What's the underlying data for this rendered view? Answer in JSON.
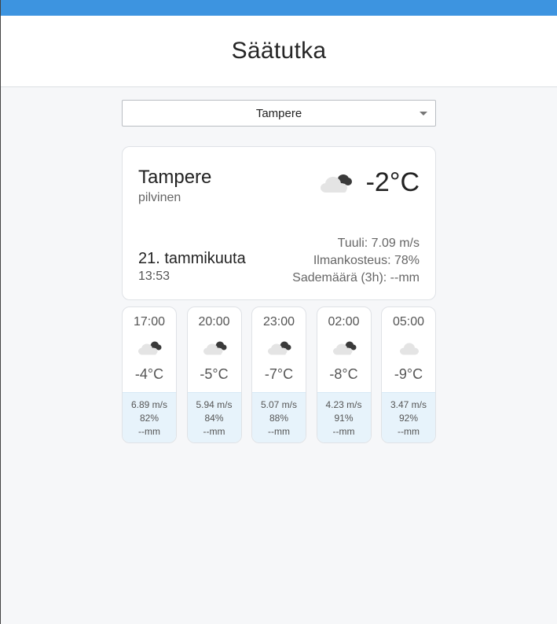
{
  "app": {
    "title": "Säätutka"
  },
  "city_select": {
    "selected": "Tampere"
  },
  "current": {
    "city": "Tampere",
    "description": "pilvinen",
    "temperature": "-2°C",
    "icon": "broken-clouds-icon",
    "date": "21. tammikuuta",
    "time": "13:53",
    "wind": "Tuuli: 7.09 m/s",
    "humidity": "Ilmankosteus: 78%",
    "precipitation": "Sademäärä (3h): --mm"
  },
  "forecast": [
    {
      "time": "17:00",
      "icon": "broken-clouds-icon",
      "temp": "-4°C",
      "wind": "6.89 m/s",
      "humidity": "82%",
      "rain": "--mm"
    },
    {
      "time": "20:00",
      "icon": "broken-clouds-icon",
      "temp": "-5°C",
      "wind": "5.94 m/s",
      "humidity": "84%",
      "rain": "--mm"
    },
    {
      "time": "23:00",
      "icon": "broken-clouds-icon",
      "temp": "-7°C",
      "wind": "5.07 m/s",
      "humidity": "88%",
      "rain": "--mm"
    },
    {
      "time": "02:00",
      "icon": "broken-clouds-icon",
      "temp": "-8°C",
      "wind": "4.23 m/s",
      "humidity": "91%",
      "rain": "--mm"
    },
    {
      "time": "05:00",
      "icon": "cloud-icon",
      "temp": "-9°C",
      "wind": "3.47 m/s",
      "humidity": "92%",
      "rain": "--mm"
    }
  ],
  "colors": {
    "accent": "#3d94e0",
    "card_bottom": "#e7f3fb",
    "background": "#f6f7f9"
  }
}
